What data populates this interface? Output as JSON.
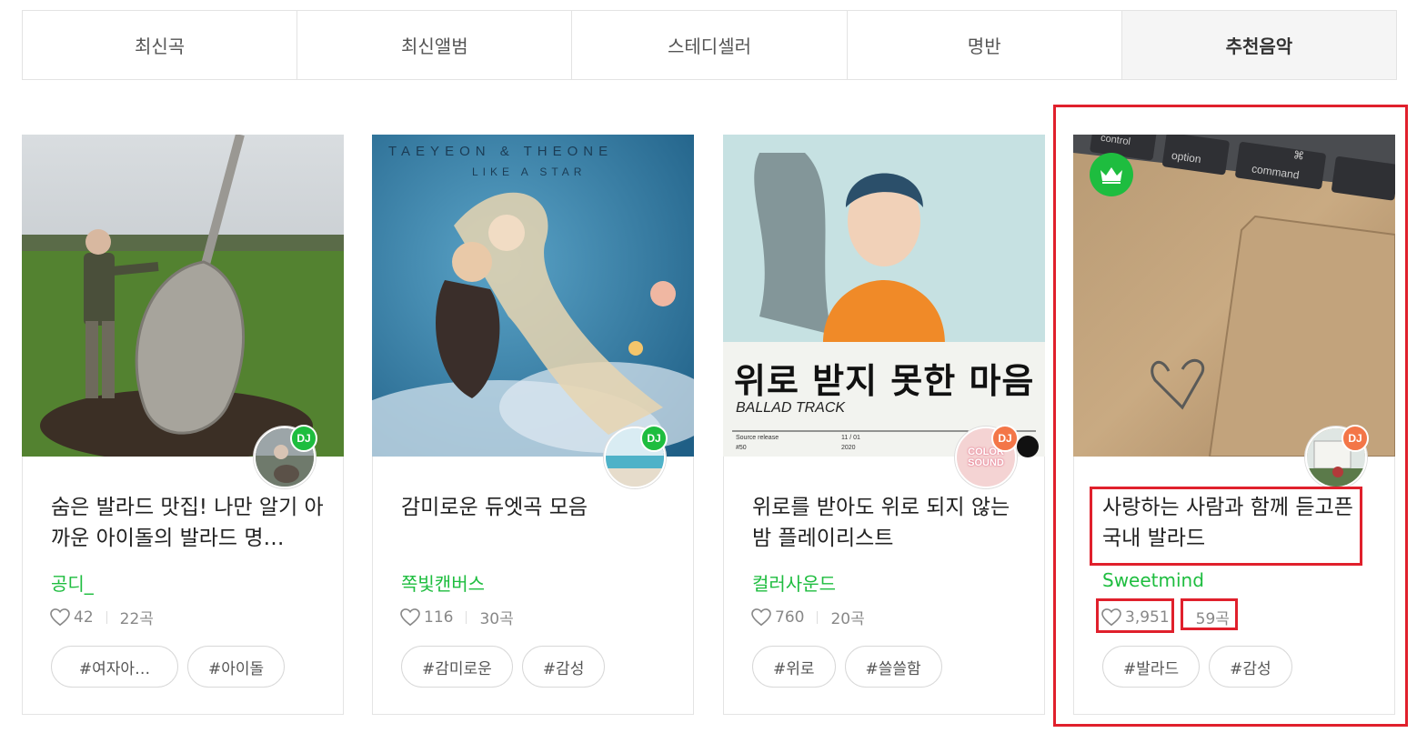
{
  "tabs": [
    {
      "label": "최신곡"
    },
    {
      "label": "최신앨범"
    },
    {
      "label": "스테디셀러"
    },
    {
      "label": "명반"
    },
    {
      "label": "추천음악",
      "active": true
    }
  ],
  "cards": [
    {
      "title": "숨은 발라드 맛집! 나만 알기 아까운 아이돌의 발라드 명…",
      "creator": "공디_",
      "likes": "42",
      "songs": "22곡",
      "tags": [
        "#여자아…",
        "#아이돌"
      ],
      "badge": "DJ",
      "badge_color": "#1ebd3f"
    },
    {
      "title": "감미로운 듀엣곡 모음",
      "creator": "쪽빛캔버스",
      "likes": "116",
      "songs": "30곡",
      "tags": [
        "#감미로운",
        "#감성"
      ],
      "badge": "DJ",
      "badge_color": "#1ebd3f",
      "cover_text": {
        "top": "TAEYEON & THEONE",
        "sub": "LIKE A STAR"
      }
    },
    {
      "title": "위로를 받아도 위로 되지 않는 밤 플레이리스트",
      "creator": "컬러사운드",
      "likes": "760",
      "songs": "20곡",
      "tags": [
        "#위로",
        "#쓸쓸함"
      ],
      "badge": "DJ",
      "badge_color": "#f37648",
      "cover_text": {
        "headline": "위로 받지 못한 마음",
        "sub": "BALLAD TRACK",
        "source": "Source release",
        "num": "#50",
        "date": "11 / 01",
        "year": "2020"
      },
      "avatar_text": "COLOR SOUND"
    },
    {
      "title": "사랑하는 사람과 함께 듣고픈 국내 발라드",
      "creator": "Sweetmind",
      "likes": "3,951",
      "songs": "59곡",
      "tags": [
        "#발라드",
        "#감성"
      ],
      "badge": "DJ",
      "badge_color": "#f37648",
      "crown": true,
      "cover_text": {
        "k1": "control",
        "k2": "option",
        "k3": "command",
        "k4": "⌘"
      }
    }
  ],
  "icons": {
    "like": "heart-outline-icon",
    "crown": "crown-icon"
  },
  "colors": {
    "accent": "#1ebd3f",
    "dj_orange": "#f37648",
    "highlight": "#e0202c"
  }
}
